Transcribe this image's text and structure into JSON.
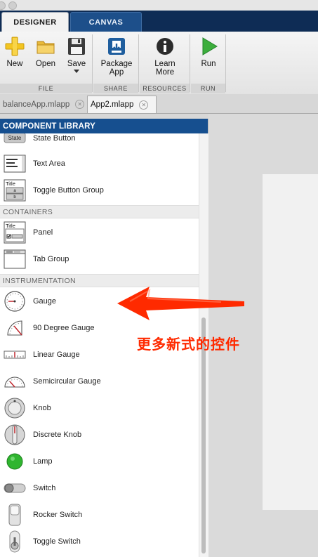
{
  "ribbon": {
    "tabs": [
      {
        "label": "DESIGNER",
        "active": true
      },
      {
        "label": "CANVAS",
        "active": false
      }
    ]
  },
  "toolbar": {
    "groups": [
      {
        "label": "FILE",
        "buttons": [
          {
            "label": "New",
            "icon": "new-plus-icon"
          },
          {
            "label": "Open",
            "icon": "folder-icon"
          },
          {
            "label": "Save",
            "icon": "floppy-disk-icon"
          }
        ]
      },
      {
        "label": "SHARE",
        "buttons": [
          {
            "label": "Package\nApp",
            "icon": "package-app-icon"
          }
        ]
      },
      {
        "label": "RESOURCES",
        "buttons": [
          {
            "label": "Learn\nMore",
            "icon": "info-icon"
          }
        ]
      },
      {
        "label": "RUN",
        "buttons": [
          {
            "label": "Run",
            "icon": "run-play-icon"
          }
        ]
      }
    ],
    "save_dropdown_icon": "chevron-down-icon"
  },
  "doc_tabs": [
    {
      "label": "balanceApp.mlapp",
      "active": false
    },
    {
      "label": "App2.mlapp",
      "active": true
    }
  ],
  "library": {
    "header": "COMPONENT LIBRARY",
    "sections": {
      "containers": "CONTAINERS",
      "instrumentation": "INSTRUMENTATION"
    },
    "items": [
      {
        "label": "State Button",
        "icon": "state-button-icon",
        "icon_text": "State"
      },
      {
        "label": "Text Area",
        "icon": "text-area-icon"
      },
      {
        "label": "Toggle Button Group",
        "icon": "toggle-button-group-icon",
        "icon_text": "Title"
      },
      {
        "label": "Panel",
        "icon": "panel-icon",
        "icon_text": "Title"
      },
      {
        "label": "Tab Group",
        "icon": "tab-group-icon"
      },
      {
        "label": "Gauge",
        "icon": "gauge-icon"
      },
      {
        "label": "90 Degree Gauge",
        "icon": "ninety-degree-gauge-icon"
      },
      {
        "label": "Linear Gauge",
        "icon": "linear-gauge-icon"
      },
      {
        "label": "Semicircular Gauge",
        "icon": "semicircular-gauge-icon"
      },
      {
        "label": "Knob",
        "icon": "knob-icon"
      },
      {
        "label": "Discrete Knob",
        "icon": "discrete-knob-icon"
      },
      {
        "label": "Lamp",
        "icon": "lamp-icon"
      },
      {
        "label": "Switch",
        "icon": "switch-icon"
      },
      {
        "label": "Rocker Switch",
        "icon": "rocker-switch-icon"
      },
      {
        "label": "Toggle Switch",
        "icon": "toggle-switch-icon"
      }
    ]
  },
  "annotation": {
    "text": "更多新式的控件",
    "color": "#ff2a00"
  },
  "colors": {
    "ribbon_bg": "#0e2c55",
    "library_header": "#164f8f",
    "lamp_green": "#2fb52f",
    "run_green": "#3cae3c"
  }
}
